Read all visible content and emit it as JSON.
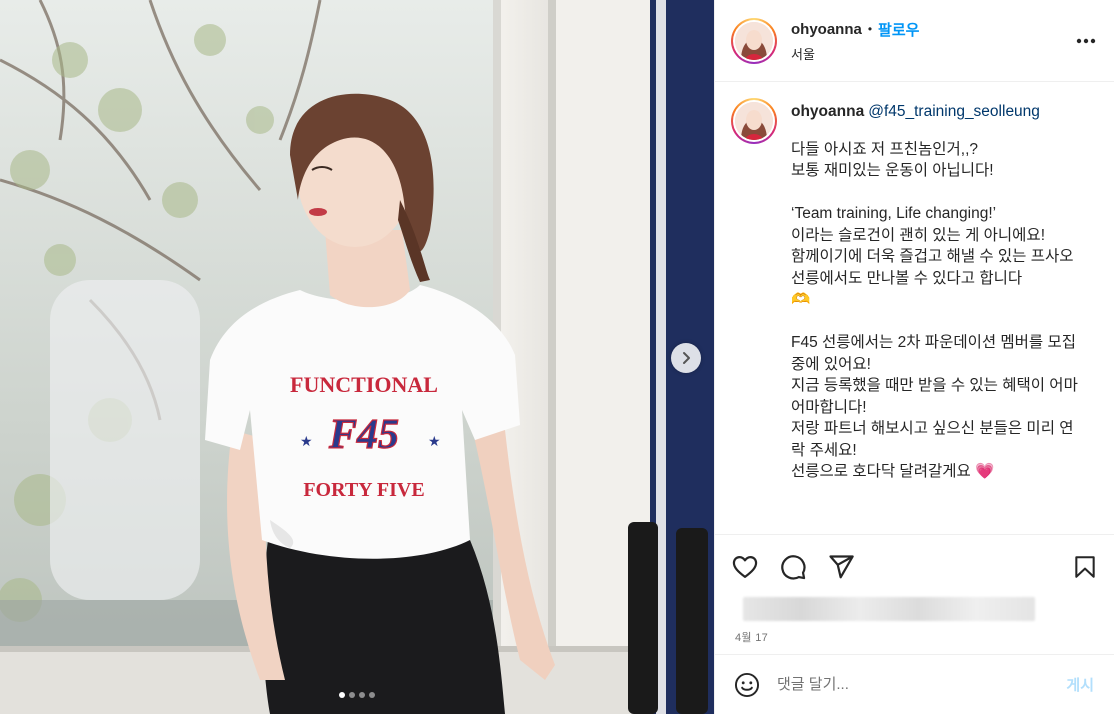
{
  "header": {
    "username": "ohyoanna",
    "separator": "•",
    "follow_label": "팔로우",
    "location": "서울"
  },
  "caption": {
    "username": "ohyoanna",
    "mention": "@f45_training_seolleung",
    "text": "다들 아시죠 저 프친놈인거,,?\n보통 재미있는 운동이 아닙니다!\n\n‘Team training, Life changing!’\n이라는 슬로건이 괜히 있는 게 아니에요!\n함께이기에 더욱 즐겁고 해낼 수 있는 프사오\n선릉에서도 만나볼 수 있다고 합니다\n🫶\n\nF45 선릉에서는 2차 파운데이션 멤버를 모집 중에 있어요!\n지금 등록했을 때만 받을 수 있는 혜택이 어마어마합니다!\n저랑 파트너 해보시고 싶으신 분들은 미리 연락 주세요!\n선릉으로 호다닥 달려갈게요 💗"
  },
  "photo": {
    "shirt_line1": "FUNCTIONAL",
    "shirt_logo": "F45",
    "shirt_line2": "FORTY FIVE",
    "carousel_total": 4,
    "carousel_active": 1
  },
  "meta": {
    "date": "4월 17"
  },
  "comment": {
    "placeholder": "댓글 달기...",
    "post_label": "게시"
  },
  "icons": {
    "more": "more-horizontal-icon",
    "like": "heart-icon",
    "comment": "comment-icon",
    "share": "paper-plane-icon",
    "save": "bookmark-icon",
    "emoji": "smiley-icon",
    "next": "chevron-right-icon"
  },
  "colors": {
    "accent": "#0095f6",
    "mention": "#00376b",
    "post_disabled": "#b2dffc",
    "muted": "#737373",
    "shirt_red": "#c8283c",
    "shirt_navy": "#2a3a8c"
  }
}
